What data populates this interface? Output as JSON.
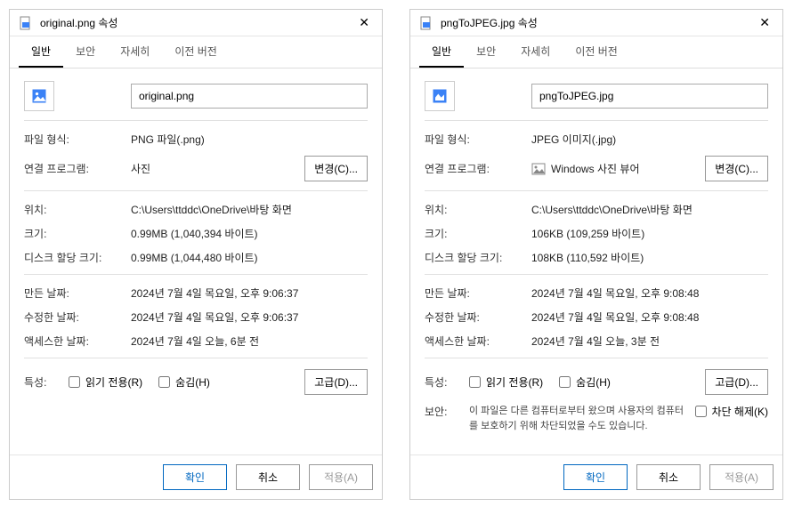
{
  "left": {
    "title": "original.png 속성",
    "tabs": [
      "일반",
      "보안",
      "자세히",
      "이전 버전"
    ],
    "filename": "original.png",
    "fields": {
      "filetype_label": "파일 형식:",
      "filetype_value": "PNG 파일(.png)",
      "opens_label": "연결 프로그램:",
      "opens_value": "사진",
      "change_btn": "변경(C)...",
      "location_label": "위치:",
      "location_value": "C:\\Users\\ttddc\\OneDrive\\바탕 화면",
      "size_label": "크기:",
      "size_value": "0.99MB (1,040,394 바이트)",
      "diskSize_label": "디스크 할당 크기:",
      "diskSize_value": "0.99MB (1,044,480 바이트)",
      "created_label": "만든 날짜:",
      "created_value": "2024년 7월 4일 목요일, 오후 9:06:37",
      "modified_label": "수정한 날짜:",
      "modified_value": "2024년 7월 4일 목요일, 오후 9:06:37",
      "accessed_label": "액세스한 날짜:",
      "accessed_value": "2024년 7월 4일 오늘, 6분 전",
      "attributes_label": "특성:",
      "readonly_label": "읽기 전용(R)",
      "hidden_label": "숨김(H)",
      "advanced_btn": "고급(D)..."
    },
    "footer": {
      "ok": "확인",
      "cancel": "취소",
      "apply": "적용(A)"
    }
  },
  "right": {
    "title": "pngToJPEG.jpg 속성",
    "tabs": [
      "일반",
      "보안",
      "자세히",
      "이전 버전"
    ],
    "filename": "pngToJPEG.jpg",
    "fields": {
      "filetype_label": "파일 형식:",
      "filetype_value": "JPEG 이미지(.jpg)",
      "opens_label": "연결 프로그램:",
      "opens_value": "Windows 사진 뷰어",
      "change_btn": "변경(C)...",
      "location_label": "위치:",
      "location_value": "C:\\Users\\ttddc\\OneDrive\\바탕 화면",
      "size_label": "크기:",
      "size_value": "106KB (109,259 바이트)",
      "diskSize_label": "디스크 할당 크기:",
      "diskSize_value": "108KB (110,592 바이트)",
      "created_label": "만든 날짜:",
      "created_value": "2024년 7월 4일 목요일, 오후 9:08:48",
      "modified_label": "수정한 날짜:",
      "modified_value": "2024년 7월 4일 목요일, 오후 9:08:48",
      "accessed_label": "액세스한 날짜:",
      "accessed_value": "2024년 7월 4일 오늘, 3분 전",
      "attributes_label": "특성:",
      "readonly_label": "읽기 전용(R)",
      "hidden_label": "숨김(H)",
      "advanced_btn": "고급(D)...",
      "security_label": "보안:",
      "security_text": "이 파일은 다른 컴퓨터로부터 왔으며 사용자의 컴퓨터를 보호하기 위해 차단되었을 수도 있습니다.",
      "unblock_label": "차단 해제(K)"
    },
    "footer": {
      "ok": "확인",
      "cancel": "취소",
      "apply": "적용(A)"
    }
  }
}
